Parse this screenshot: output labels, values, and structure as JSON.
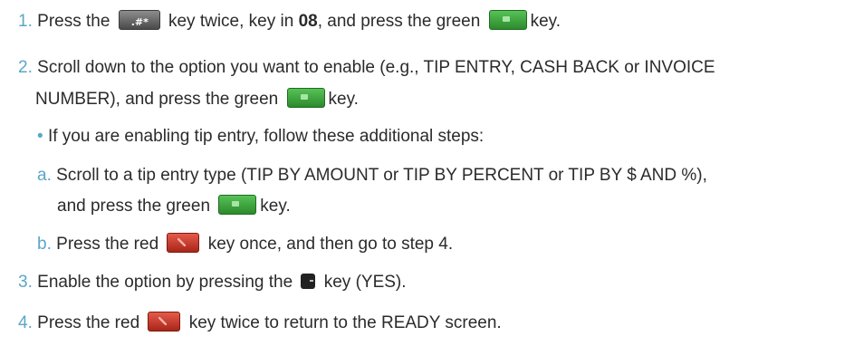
{
  "steps": {
    "s1": {
      "num": "1.",
      "t1": "Press the",
      "t2": "key twice, key in",
      "bold": "08",
      "t3": ", and press the green",
      "t4": "key.",
      "hash_key": ".#*"
    },
    "s2": {
      "num": "2.",
      "line1": "Scroll down to the option you want to enable (e.g., TIP ENTRY, CASH BACK or INVOICE",
      "line2a": "NUMBER), and press the green",
      "line2b": "key."
    },
    "bullet": {
      "mark": "•",
      "text": "If you are enabling tip entry, follow these additional steps:"
    },
    "sa": {
      "num": "a.",
      "line1": "Scroll to a tip entry type (TIP BY AMOUNT or TIP BY PERCENT or TIP BY $ AND %),",
      "line2a": "and press the green",
      "line2b": "key."
    },
    "sb": {
      "num": "b.",
      "t1": "Press the red",
      "t2": "key once, and then go to step 4."
    },
    "s3": {
      "num": "3.",
      "t1": "Enable the option by pressing the",
      "t2": "key (YES)."
    },
    "s4": {
      "num": "4.",
      "t1": "Press the red",
      "t2": "key twice to return to the READY screen."
    }
  },
  "icons": {
    "hash": "hash-key-icon",
    "green": "green-enter-key-icon",
    "red": "red-cancel-key-icon",
    "black": "black-softkey-icon"
  },
  "colors": {
    "number": "#5aa6c8",
    "text": "#2b2b2b",
    "green_key": "#2c8a2c",
    "red_key": "#a8261a"
  }
}
